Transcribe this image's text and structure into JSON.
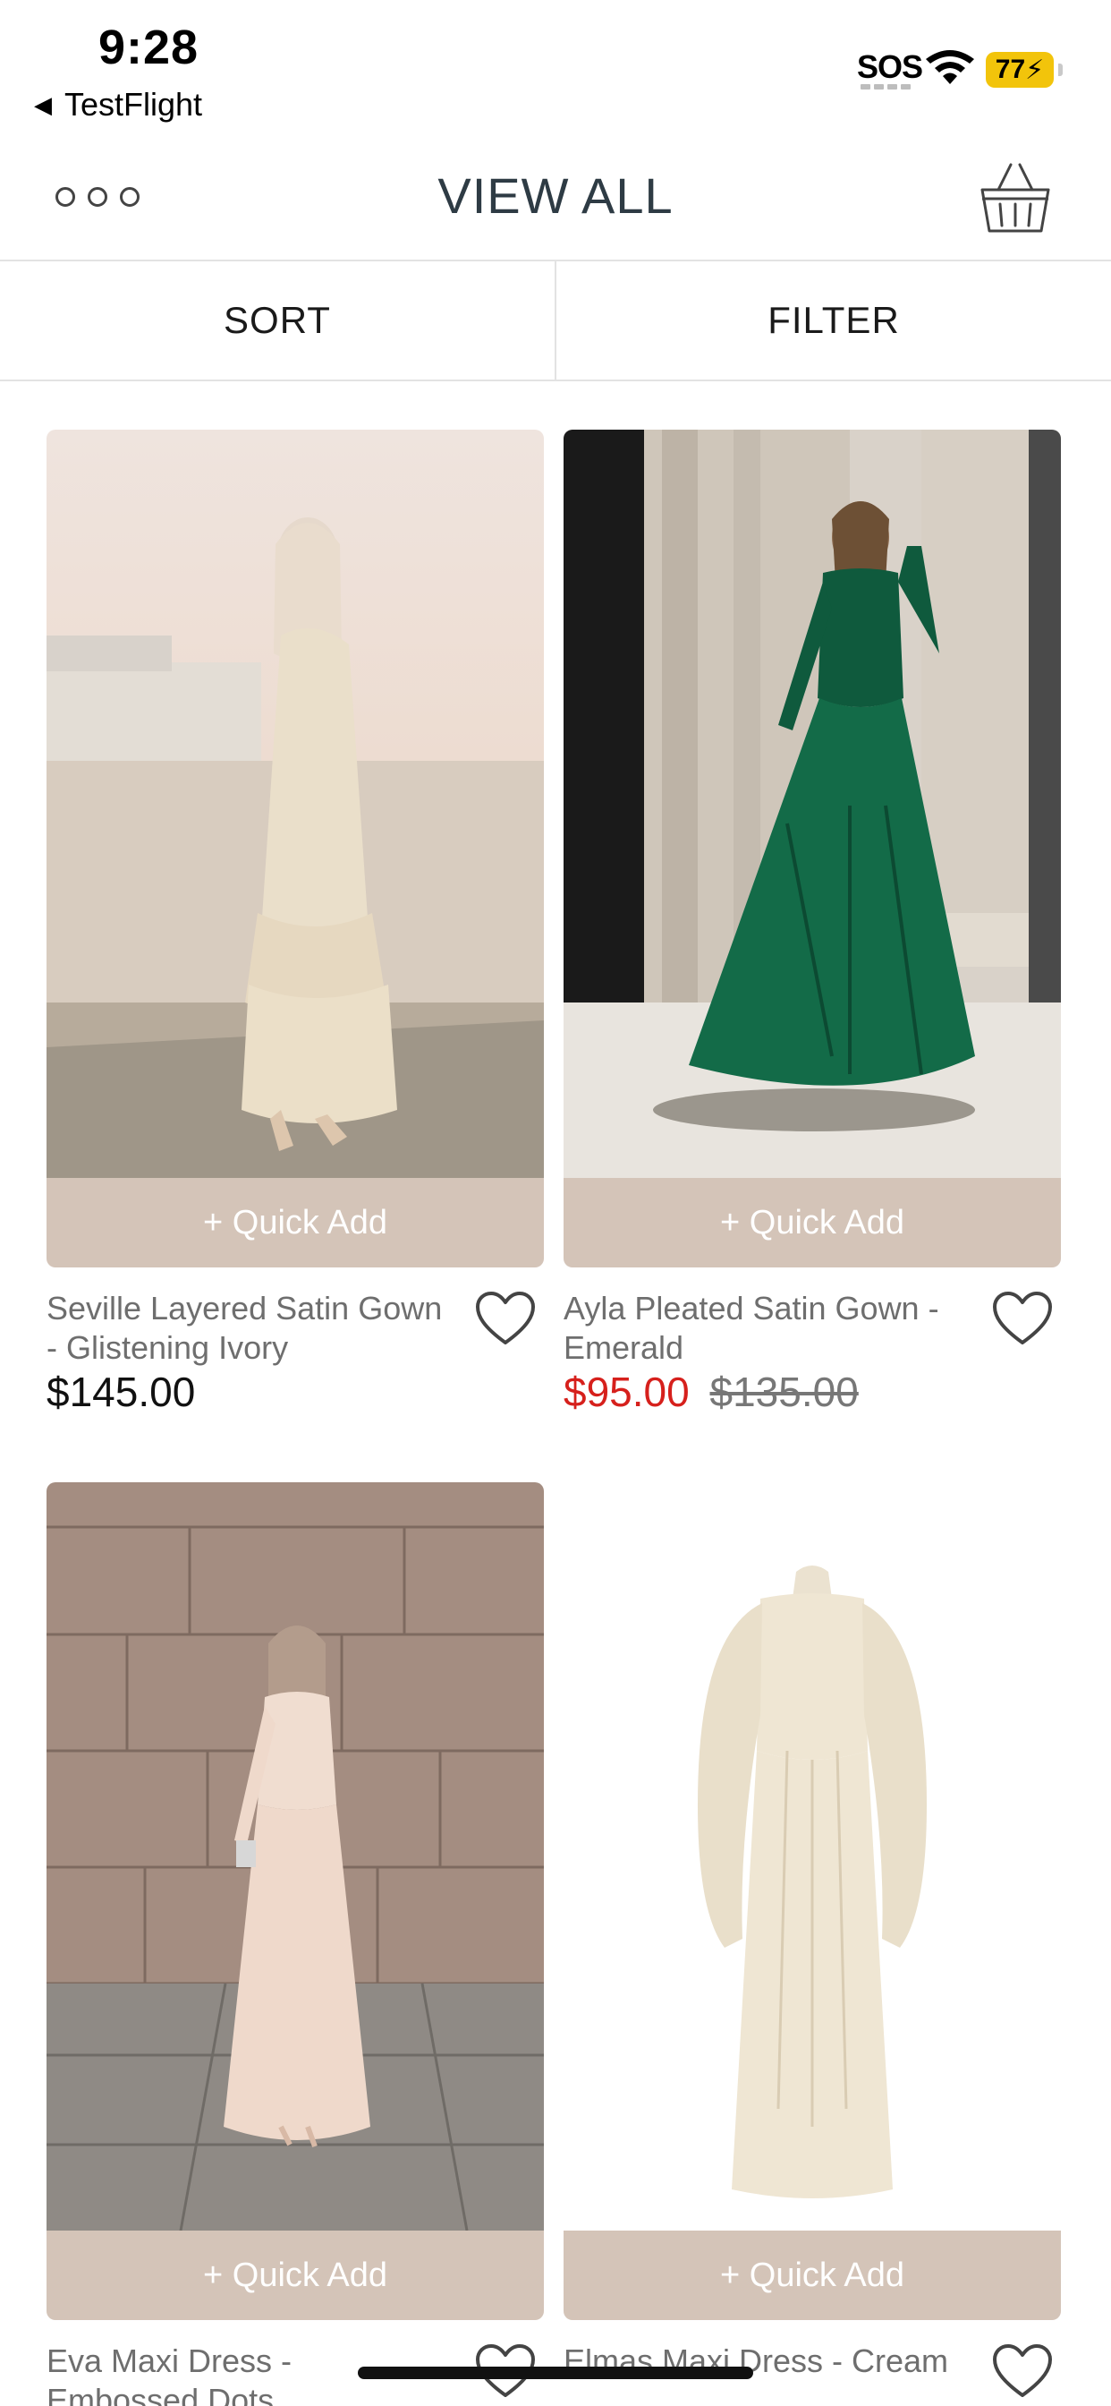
{
  "status_bar": {
    "time": "9:28",
    "back_app": "TestFlight",
    "sos": "SOS",
    "battery": "77"
  },
  "header": {
    "title": "VIEW ALL"
  },
  "toolbar": {
    "sort_label": "SORT",
    "filter_label": "FILTER"
  },
  "colors": {
    "quick_add_bg": "#d4c4b8",
    "sale_price": "#d6201c",
    "battery": "#f2c40b"
  },
  "products": [
    {
      "name": "Seville Layered Satin Gown - Glistening Ivory",
      "quick_add": "+ Quick Add",
      "price": "$145.00",
      "sale_price": "",
      "original_price": ""
    },
    {
      "name": "Ayla Pleated Satin Gown - Emerald",
      "quick_add": "+ Quick Add",
      "price": "",
      "sale_price": "$95.00",
      "original_price": "$135.00"
    },
    {
      "name": "Eva Maxi Dress - Embossed Dots",
      "quick_add": "+ Quick Add",
      "price": "",
      "sale_price": "",
      "original_price": ""
    },
    {
      "name": "Elmas Maxi Dress - Cream",
      "quick_add": "+ Quick Add",
      "price": "",
      "sale_price": "",
      "original_price": ""
    }
  ]
}
